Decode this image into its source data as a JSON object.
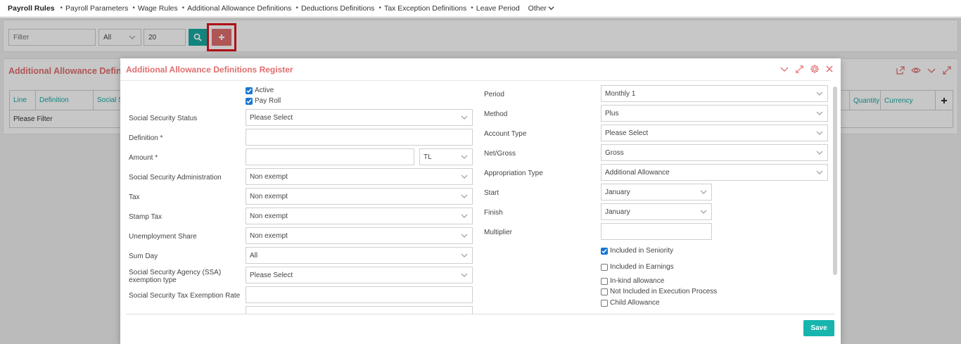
{
  "nav": {
    "items": [
      "Payroll Rules",
      "Payroll Parameters",
      "Wage Rules",
      "Additional Allowance Definitions",
      "Deductions Definitions",
      "Tax Exception Definitions",
      "Leave Period"
    ],
    "separator": "•",
    "other_label": "Other"
  },
  "filterbar": {
    "filter_placeholder": "Filter",
    "scope_value": "All",
    "page_size": "20"
  },
  "panel": {
    "title": "Additional Allowance Definiti",
    "columns": [
      "Line",
      "Definition",
      "Social S"
    ],
    "right_columns": [
      "Quantity",
      "Currency"
    ],
    "empty_text": "Please Filter"
  },
  "modal": {
    "title": "Additional Allowance Definitions Register",
    "save_label": "Save",
    "left": {
      "active_label": "Active",
      "payroll_label": "Pay Roll",
      "fields": [
        {
          "label": "Social Security Status",
          "value": "Please Select",
          "select": true
        },
        {
          "label": "Definition *",
          "value": "",
          "select": false
        },
        {
          "label": "Amount *",
          "value": "",
          "select": false
        },
        {
          "label": "Social Security Administration",
          "value": "Non exempt",
          "select": true
        },
        {
          "label": "Tax",
          "value": "Non exempt",
          "select": true
        },
        {
          "label": "Stamp Tax",
          "value": "Non exempt",
          "select": true
        },
        {
          "label": "Unemployment Share",
          "value": "Non exempt",
          "select": true
        },
        {
          "label": "Sum Day",
          "value": "All",
          "select": true
        },
        {
          "label": "Social Security Agency (SSA) exemption type",
          "value": "Please Select",
          "select": true
        },
        {
          "label": "Social Security Tax Exemption Rate",
          "value": "",
          "select": false
        }
      ],
      "currency_value": "TL"
    },
    "right": {
      "fields": [
        {
          "label": "Period",
          "value": "Monthly 1"
        },
        {
          "label": "Method",
          "value": "Plus"
        },
        {
          "label": "Account Type",
          "value": "Please Select"
        },
        {
          "label": "Net/Gross",
          "value": "Gross"
        },
        {
          "label": "Appropriation Type",
          "value": "Additional Allowance"
        },
        {
          "label": "Start",
          "value": "January"
        },
        {
          "label": "Finish",
          "value": "January"
        },
        {
          "label": "Multiplier",
          "value": ""
        }
      ],
      "checkboxes": [
        {
          "label": "Included in Seniority",
          "checked": true
        },
        {
          "label": "Included in Earnings",
          "checked": false
        },
        {
          "label": "In-kind allowance",
          "checked": false
        },
        {
          "label": "Not Included in Execution Process",
          "checked": false
        },
        {
          "label": "Child Allowance",
          "checked": false
        }
      ]
    }
  },
  "colors": {
    "accent": "#e06e6e",
    "teal": "#17a9a2",
    "highlight": "#e0141e"
  }
}
